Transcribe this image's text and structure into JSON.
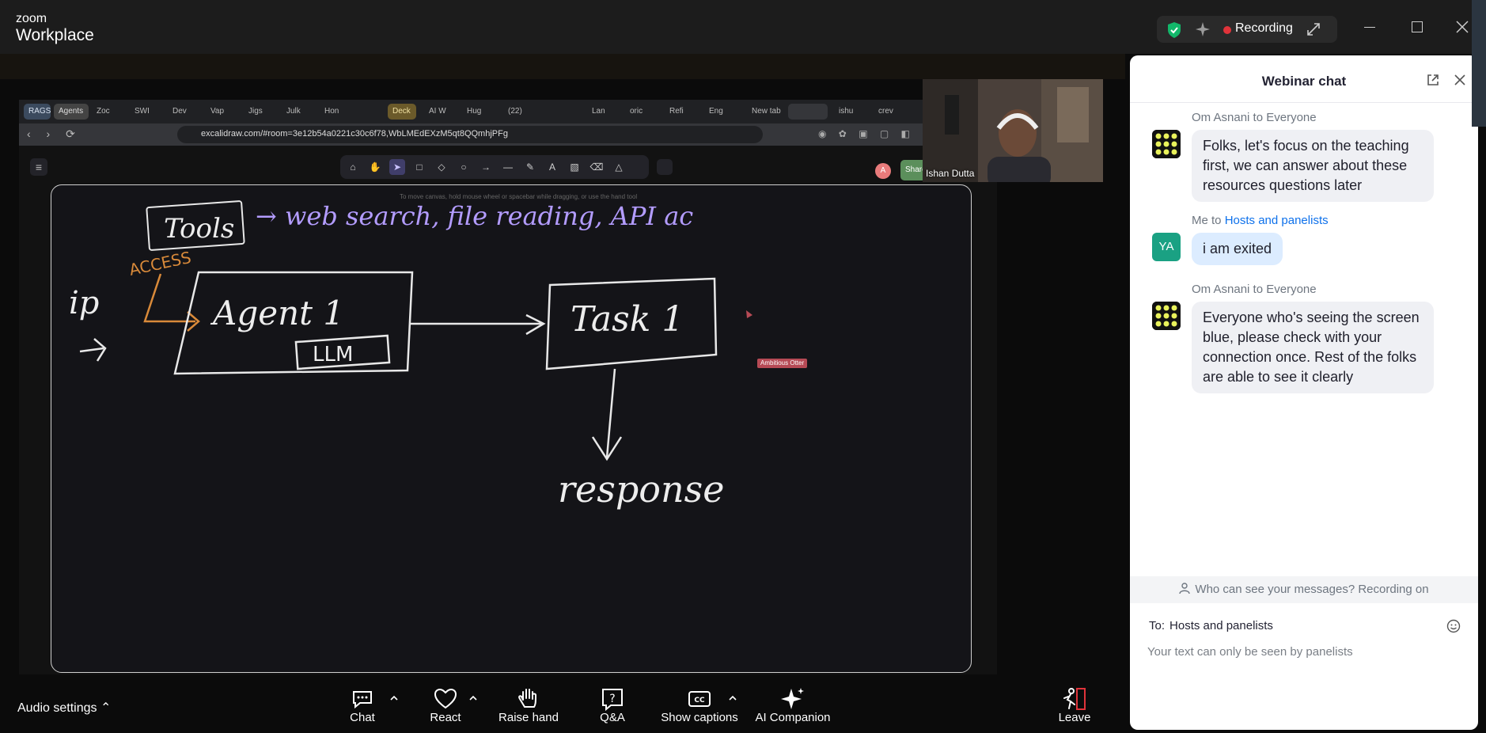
{
  "app": {
    "brand_top": "zoom",
    "brand_bottom": "Workplace"
  },
  "status": {
    "recording_label": "Recording"
  },
  "browser": {
    "tabs": [
      "RAGS",
      "Agents",
      "Zoc",
      "SWI",
      "Dev",
      "Vap",
      "Jigs",
      "Julk",
      "Hon",
      "Deck",
      "AI W",
      "Hug",
      "(22)",
      "",
      "Lan",
      "oric",
      "Refi",
      "Eng",
      "New tab",
      "",
      "ishu",
      "crev"
    ],
    "url": "excalidraw.com/#room=3e12b54a0221c30c6f78,WbLMEdEXzM5qt8QQmhjPFg"
  },
  "excalidraw": {
    "hint": "To move canvas, hold mouse wheel or spacebar while dragging, or use the hand tool",
    "collaborator_initial": "A",
    "share_label": "Share",
    "cursor_user": "Ambitious Otter",
    "drawing": {
      "tools_label": "Tools",
      "tools_arrow_text": "→ web search, file reading, API ac",
      "access_label": "ACCESS",
      "ip_label": "ip",
      "agent_label": "Agent 1",
      "llm_label": "LLM",
      "task_label": "Task 1",
      "response_label": "response"
    }
  },
  "video": {
    "participant_name": "Ishan Dutta"
  },
  "chat": {
    "title": "Webinar chat",
    "messages": [
      {
        "sender": "Om Asnani",
        "to_prefix": " to ",
        "to": "Everyone",
        "text": "Folks, let's focus on the teaching first, we can answer about these resources questions later"
      },
      {
        "sender": "Me",
        "to_prefix": " to ",
        "to": "Hosts and panelists",
        "avatar": "YA",
        "text": "i am exited"
      },
      {
        "sender": "Om Asnani",
        "to_prefix": " to ",
        "to": "Everyone",
        "text": "Everyone who's seeing the screen blue, please check with your connection once. Rest of the folks are able to see it clearly"
      }
    ],
    "privacy_notice": "Who can see your messages? Recording on",
    "to_label": "To:",
    "to_value": "Hosts and panelists",
    "input_placeholder": "Your text can only be seen by panelists"
  },
  "controls": {
    "audio_settings": "Audio settings",
    "chat": "Chat",
    "react": "React",
    "raise_hand": "Raise hand",
    "qa": "Q&A",
    "show_captions": "Show captions",
    "ai_companion": "AI Companion",
    "leave": "Leave"
  },
  "colors": {
    "recording_red": "#e0333a",
    "link_blue": "#0e71eb",
    "drawing_purple": "#b39cff",
    "access_orange": "#d98a3a",
    "leave_red": "#e0333a"
  }
}
